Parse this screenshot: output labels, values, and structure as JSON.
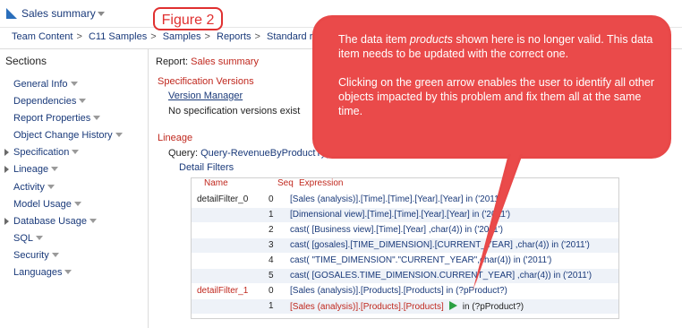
{
  "app": {
    "title": "Sales summary"
  },
  "figure_label": "Figure 2",
  "breadcrumb": [
    "Team Content",
    "C11 Samples",
    "Samples",
    "Reports",
    "Standard re"
  ],
  "sidebar": {
    "title": "Sections",
    "items": [
      {
        "label": "General Info",
        "tri": false
      },
      {
        "label": "Dependencies",
        "tri": false
      },
      {
        "label": "Report Properties",
        "tri": false
      },
      {
        "label": "Object Change History",
        "tri": false
      },
      {
        "label": "Specification",
        "tri": true
      },
      {
        "label": "Lineage",
        "tri": true
      },
      {
        "label": "Activity",
        "tri": false
      },
      {
        "label": "Model Usage",
        "tri": false
      },
      {
        "label": "Database Usage",
        "tri": true
      },
      {
        "label": "SQL",
        "tri": false
      },
      {
        "label": "Security",
        "tri": false
      },
      {
        "label": "Languages",
        "tri": false
      }
    ]
  },
  "main": {
    "report_label": "Report:",
    "report_name": "Sales summary",
    "spec_versions": {
      "heading": "Specification Versions",
      "link": "Version Manager",
      "note": "No specification versions exist"
    },
    "lineage": {
      "heading": "Lineage",
      "query_label": "Query:",
      "query_value": "Query-RevenueByProductTyp",
      "detail_filters": "Detail Filters"
    },
    "table": {
      "headers": [
        "Name",
        "Seq",
        "Expression"
      ],
      "rows": [
        {
          "name": "detailFilter_0",
          "seq": "0",
          "expr": "[Sales (analysis)].[Time].[Time].[Year].[Year] in ('2011')",
          "red": false
        },
        {
          "name": "",
          "seq": "1",
          "expr": "[Dimensional view].[Time].[Time].[Year].[Year] in ('2011')",
          "red": false
        },
        {
          "name": "",
          "seq": "2",
          "expr": "cast( [Business view].[Time].[Year] ,char(4)) in ('2011')",
          "red": false
        },
        {
          "name": "",
          "seq": "3",
          "expr": "cast( [gosales].[TIME_DIMENSION].[CURRENT_YEAR] ,char(4)) in ('2011')",
          "red": false
        },
        {
          "name": "",
          "seq": "4",
          "expr": "cast( \"TIME_DIMENSION\".\"CURRENT_YEAR\",char(4)) in ('2011')",
          "red": false
        },
        {
          "name": "",
          "seq": "5",
          "expr": "cast( [GOSALES.TIME_DIMENSION.CURRENT_YEAR] ,char(4)) in ('2011')",
          "red": false
        },
        {
          "name": "detailFilter_1",
          "seq": "0",
          "expr": "[Sales (analysis)].[Products].[Products] in (?pProduct?)",
          "red": true
        },
        {
          "name": "",
          "seq": "1",
          "expr": "[Sales (analysis)].[Products].[Products]",
          "expr_tail": "in (?pProduct?)",
          "red": true,
          "play": true
        }
      ]
    }
  },
  "callout": {
    "para1_a": "The data item ",
    "para1_em": "products",
    "para1_b": " shown here is no longer valid. This data item needs to be updated with the correct one.",
    "para2": "Clicking on the green arrow enables the user to identify all other objects impacted by this problem and fix them all at the same time."
  },
  "colors": {
    "accent_red": "#c0281e",
    "link_blue": "#1a3a7a",
    "callout_red": "#e84848",
    "play_green": "#2aa042"
  }
}
